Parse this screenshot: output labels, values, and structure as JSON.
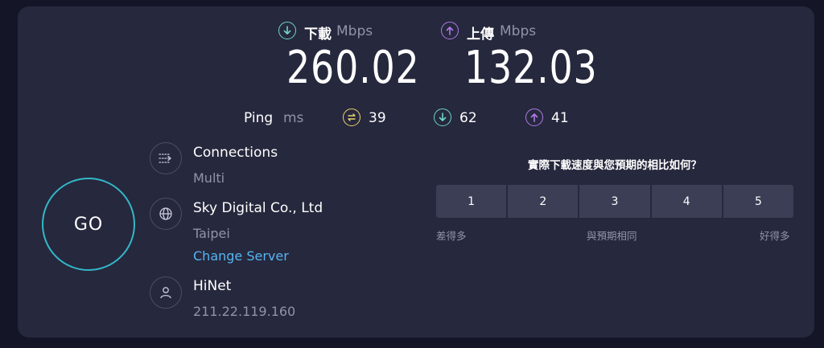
{
  "download": {
    "title": "下載",
    "unit": "Mbps",
    "value": "260.02",
    "icon": "arrow-down-circle-icon",
    "color": "#6fd6c9"
  },
  "upload": {
    "title": "上傳",
    "unit": "Mbps",
    "value": "132.03",
    "icon": "arrow-up-circle-icon",
    "color": "#b07bea"
  },
  "ping": {
    "label": "Ping",
    "unit": "ms",
    "idle": "39",
    "download": "62",
    "upload": "41",
    "idle_color": "#efd26b"
  },
  "go": {
    "label": "GO"
  },
  "connections": {
    "title": "Connections",
    "value": "Multi"
  },
  "server": {
    "name": "Sky Digital Co., Ltd",
    "location": "Taipei",
    "change_label": "Change Server"
  },
  "isp": {
    "name": "HiNet",
    "ip": "211.22.119.160"
  },
  "survey": {
    "question": "實際下載速度與您預期的相比如何？",
    "options": [
      "1",
      "2",
      "3",
      "4",
      "5"
    ],
    "low_label": "差得多",
    "mid_label": "與預期相同",
    "high_label": "好得多"
  }
}
